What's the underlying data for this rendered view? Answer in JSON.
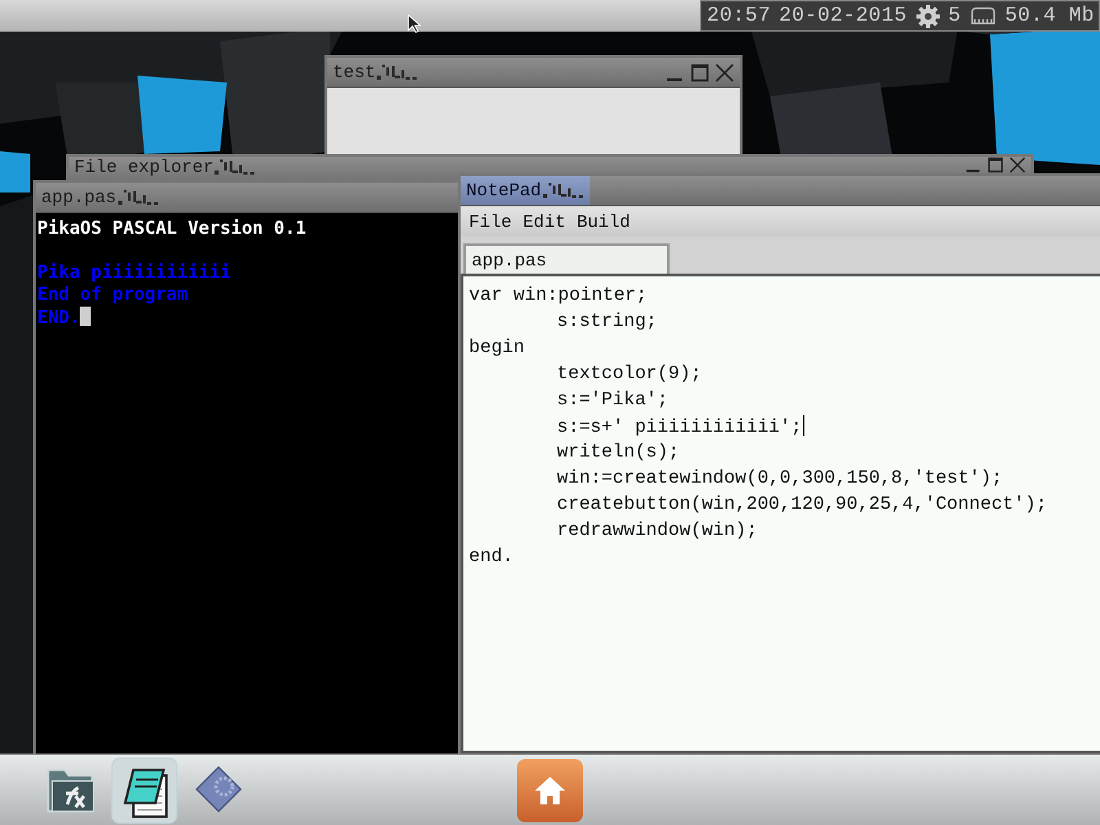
{
  "top_bar": {
    "time": "20:57",
    "date": "20-02-2015",
    "task_count": "5",
    "memory": "50.4 Mb"
  },
  "test_window": {
    "title": "test",
    "active": false
  },
  "file_explorer": {
    "title": "File explorer",
    "active": false
  },
  "console_window": {
    "title": "app.pas",
    "active": false,
    "header": {
      "text": "PikaOS PASCAL Version 0.1",
      "color": "#ffffff"
    },
    "lines": [
      {
        "text": "Pika piiiiiiiiiiii",
        "color": "#0000ff",
        "cursor": false
      },
      {
        "text": "End of program",
        "color": "#0000ff",
        "cursor": false
      },
      {
        "text": "END.",
        "color": "#0000ff",
        "cursor": true
      }
    ]
  },
  "notepad": {
    "title": "NotePad",
    "active": true,
    "menu": [
      "File",
      "Edit",
      "Build"
    ],
    "tabs": [
      {
        "label": "app.pas",
        "selected": true
      }
    ],
    "code": [
      {
        "text": "var win:pointer;",
        "caret": false,
        "children": [
          {
            "text": "s:string;",
            "caret": false
          }
        ]
      },
      {
        "text": "begin",
        "caret": false,
        "children": [
          {
            "text": "textcolor(9);",
            "caret": false
          },
          {
            "text": "s:='Pika';",
            "caret": false
          },
          {
            "text": "s:=s+' piiiiiiiiiiii';",
            "caret": true
          },
          {
            "text": "writeln(s);",
            "caret": false
          },
          {
            "text": "win:=createwindow(0,0,300,150,8,'test');",
            "caret": false
          },
          {
            "text": "createbutton(win,200,120,90,25,4,'Connect');",
            "caret": false
          },
          {
            "text": "redrawwindow(win);",
            "caret": false
          }
        ]
      },
      {
        "text": "end.",
        "caret": false
      }
    ]
  },
  "taskbar": {
    "apps": [
      {
        "kind": "folder",
        "selected": false
      },
      {
        "kind": "notepad",
        "selected": true
      },
      {
        "kind": "settings",
        "selected": false
      }
    ],
    "home": {
      "kind": "home"
    }
  }
}
